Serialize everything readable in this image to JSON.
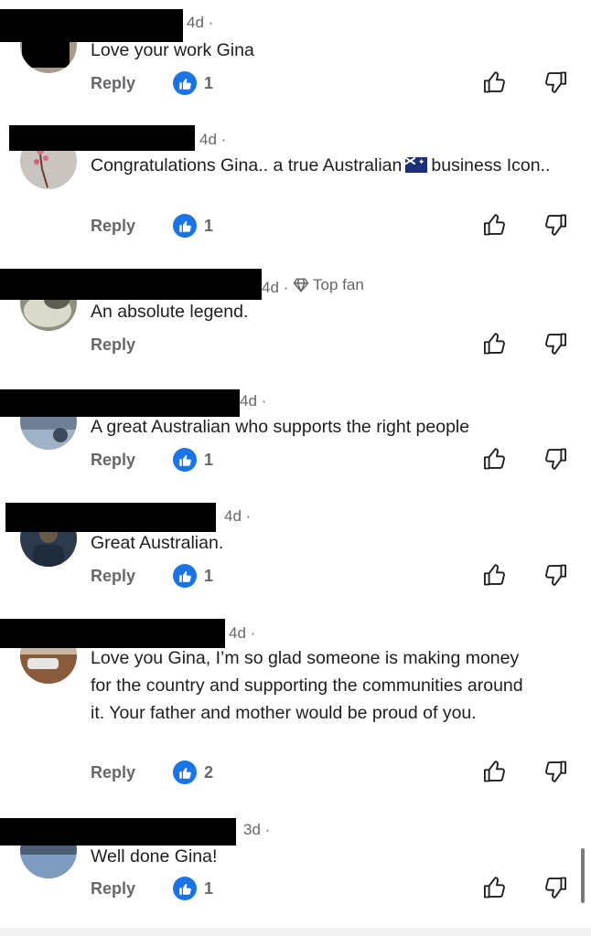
{
  "comments": [
    {
      "time": "4d ·",
      "text": "Love your work Gina",
      "likes": "1"
    },
    {
      "time": "4d ·",
      "text_a": "Congratulations Gina.. a true Australian",
      "text_b": "business Icon..",
      "likes": "1"
    },
    {
      "time": "4d ·",
      "badge": "Top fan",
      "text": "An absolute legend.",
      "likes": ""
    },
    {
      "time": "4d ·",
      "text": "A great Australian who supports the right people",
      "likes": "1"
    },
    {
      "time": "4d ·",
      "text": "Great Australian.",
      "likes": "1"
    },
    {
      "time": "4d ·",
      "text": "Love you Gina, I’m so glad someone is making money for the country and supporting the communities around it. Your father and mother would be proud of you.",
      "likes": "2"
    },
    {
      "time": "3d ·",
      "text": "Well done Gina!",
      "likes": "1"
    }
  ],
  "labels": {
    "reply": "Reply"
  },
  "icons": {
    "like_badge": "thumbs-up-filled-icon",
    "like": "thumbs-up-outline-icon",
    "dislike": "thumbs-down-outline-icon",
    "top_fan": "diamond-icon"
  },
  "colors": {
    "like_badge": "#1b74e4",
    "meta_text": "#65676b",
    "body_text": "#1c1e21"
  }
}
